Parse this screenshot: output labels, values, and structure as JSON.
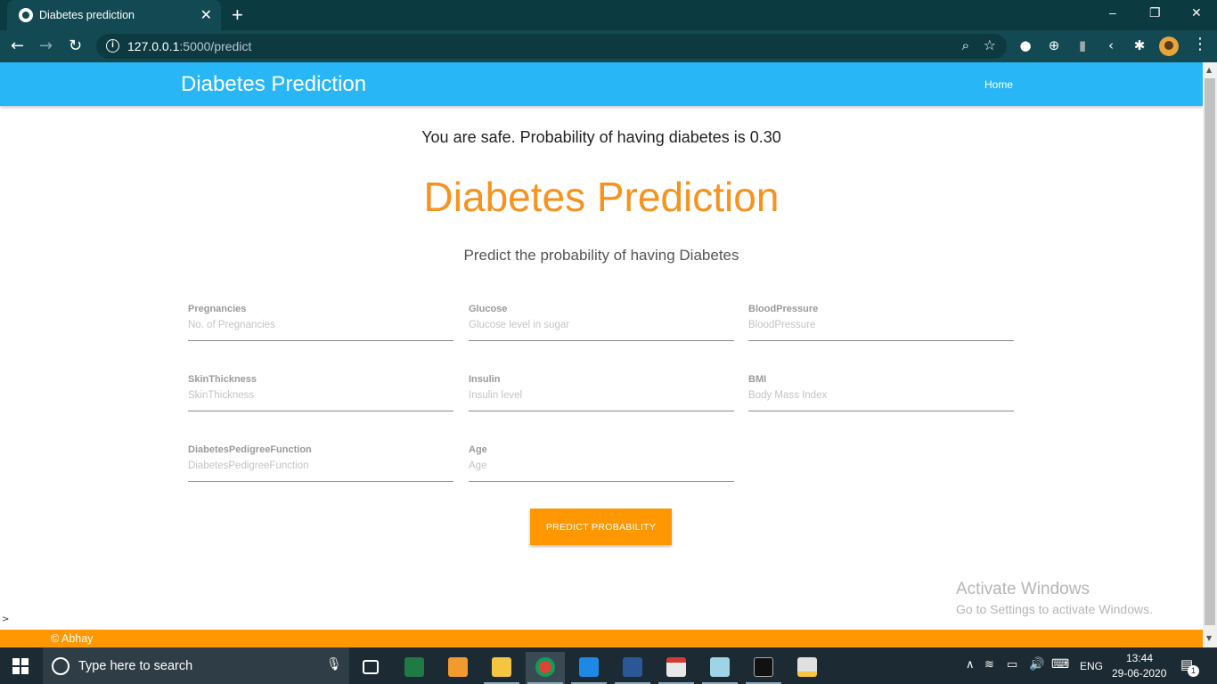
{
  "browser": {
    "tab_title": "Diabetes prediction",
    "tab_close": "✕",
    "new_tab": "+",
    "url_host": "127.0.0.1",
    "url_path": ":5000/predict",
    "window_controls": [
      "–",
      "❐",
      "✕"
    ]
  },
  "navbar": {
    "brand": "Diabetes Prediction",
    "home_link": "Home"
  },
  "result": {
    "text": "You are safe. Probability of having diabetes is 0.30"
  },
  "main": {
    "heading": "Diabetes Prediction",
    "subheading": "Predict the probability of having Diabetes",
    "fields": [
      {
        "label": "Pregnancies",
        "placeholder": "No. of Pregnancies",
        "value": ""
      },
      {
        "label": "Glucose",
        "placeholder": "Glucose level in sugar",
        "value": ""
      },
      {
        "label": "BloodPressure",
        "placeholder": "BloodPressure",
        "value": ""
      },
      {
        "label": "SkinThickness",
        "placeholder": "SkinThickness",
        "value": ""
      },
      {
        "label": "Insulin",
        "placeholder": "Insulin level",
        "value": ""
      },
      {
        "label": "BMI",
        "placeholder": "Body Mass Index",
        "value": ""
      },
      {
        "label": "DiabetesPedigreeFunction",
        "placeholder": "DiabetesPedigreeFunction",
        "value": ""
      },
      {
        "label": "Age",
        "placeholder": "Age",
        "value": ""
      }
    ],
    "submit_label": "PREDICT PROBABILITY"
  },
  "watermark": {
    "line1": "Activate Windows",
    "line2": "Go to Settings to activate Windows."
  },
  "footer": {
    "text": "© Abhay"
  },
  "taskbar": {
    "search_placeholder": "Type here to search",
    "language": "ENG",
    "time": "13:44",
    "date": "29-06-2020",
    "notification_count": "1"
  },
  "colors": {
    "navbar": "#29b6f6",
    "accent_orange": "#ff9800",
    "heading_orange": "#f5931e",
    "browser_frame": "#124952"
  }
}
